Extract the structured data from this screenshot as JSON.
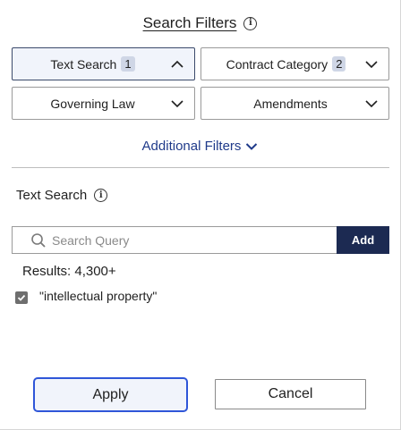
{
  "header": {
    "title": "Search Filters",
    "info_icon": "info-icon"
  },
  "filters": [
    {
      "label": "Text Search",
      "badge": "1",
      "state": "expanded",
      "chevron": "chevron-up-icon"
    },
    {
      "label": "Contract Category",
      "badge": "2",
      "state": "collapsed",
      "chevron": "chevron-down-icon"
    },
    {
      "label": "Governing Law",
      "state": "collapsed",
      "chevron": "chevron-down-icon"
    },
    {
      "label": "Amendments",
      "state": "collapsed",
      "chevron": "chevron-down-icon"
    }
  ],
  "additional_filters": {
    "label": "Additional Filters",
    "icon": "chevron-down-icon"
  },
  "text_search": {
    "title": "Text Search",
    "search_placeholder": "Search Query",
    "search_value": "",
    "add_label": "Add",
    "results_label": "Results: 4,300+",
    "terms": [
      {
        "label": "\"intellectual property\"",
        "checked": true
      }
    ]
  },
  "footer": {
    "apply_label": "Apply",
    "cancel_label": "Cancel"
  },
  "colors": {
    "accent": "#1c2a52",
    "link": "#1f3a8a",
    "focus": "#2f56d8",
    "active_bg": "#f1f4fb",
    "badge_bg": "#cfd6e6"
  }
}
